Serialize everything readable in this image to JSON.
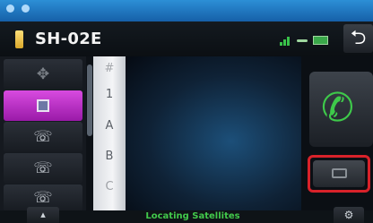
{
  "status_bar": {
    "icons": [
      "bluetooth-icon",
      "connection-icon"
    ]
  },
  "header": {
    "device_name": "SH-02E",
    "icons": [
      "signal-icon",
      "link-icon",
      "battery-icon"
    ],
    "back_icon": "back-arrow-icon"
  },
  "left_rail": {
    "items": [
      {
        "icon": "voice-dial-icon",
        "active": false
      },
      {
        "icon": "phonebook-icon",
        "active": true
      },
      {
        "icon": "incoming-call-icon",
        "active": false
      },
      {
        "icon": "missed-call-icon",
        "active": false
      },
      {
        "icon": "outgoing-call-icon",
        "active": false
      }
    ]
  },
  "index_strip": {
    "items": [
      "#",
      "1",
      "A",
      "B",
      "C"
    ]
  },
  "right_panel": {
    "call_icon": "handset-icon",
    "device_icon": "phone-device-icon"
  },
  "footer": {
    "status_text": "Locating Satellites",
    "left_icon": "menu-icon",
    "right_icon": "settings-icon"
  },
  "colors": {
    "active": "#b42ac0",
    "accent_green": "#3ec94a",
    "highlight_red": "#d8222a",
    "status_bar_blue": "#1f7cc8"
  }
}
